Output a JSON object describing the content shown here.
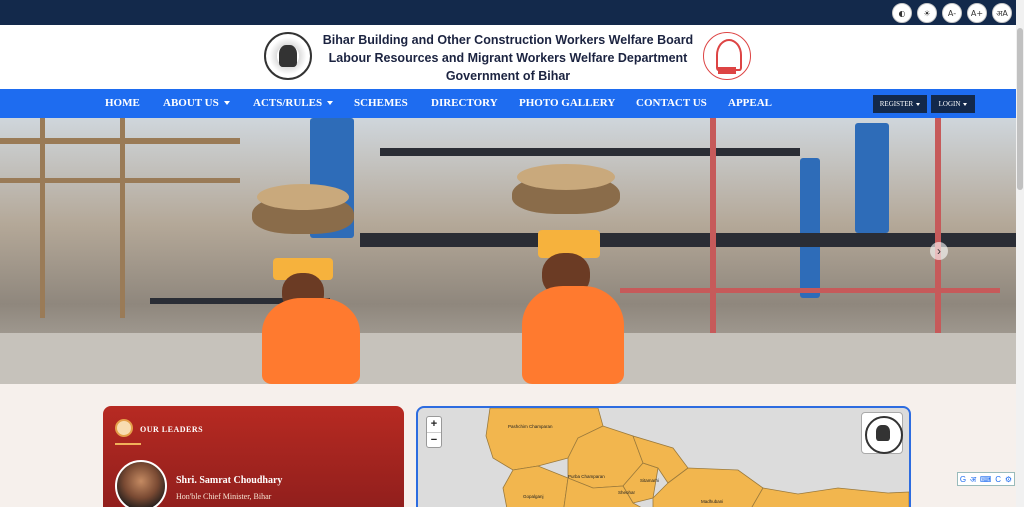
{
  "accessibility": {
    "buttons": [
      {
        "label": "◐",
        "icon": "contrast-icon"
      },
      {
        "label": "☀",
        "icon": "brightness-icon"
      },
      {
        "label": "A-",
        "icon": "font-decrease-icon"
      },
      {
        "label": "A+",
        "icon": "font-increase-icon"
      },
      {
        "label": "अA",
        "icon": "language-icon"
      }
    ]
  },
  "header": {
    "line1": "Bihar Building and Other Construction Workers Welfare Board",
    "line2": "Labour Resources and Migrant Workers Welfare Department",
    "line3": "Government of Bihar"
  },
  "nav": {
    "items": [
      "HOME",
      "ABOUT US",
      "ACTS/RULES",
      "SCHEMES",
      "DIRECTORY",
      "PHOTO GALLERY",
      "CONTACT US",
      "APPEAL"
    ],
    "register": "REGISTER",
    "login": "LOGIN"
  },
  "hero": {
    "next_arrow": "›"
  },
  "leaders": {
    "title": "OUR LEADERS",
    "name": "Shri. Samrat Choudhary",
    "role": "Hon'ble Chief Minister, Bihar"
  },
  "map": {
    "zoom_in": "+",
    "zoom_out": "−",
    "districts": [
      "Pashchim Champaran",
      "Purba Champaran",
      "Sitamarhi",
      "Gopalganj",
      "Sheohar",
      "Madhubani"
    ]
  },
  "translate": {
    "labels": [
      "G",
      "अ",
      "⌨",
      "C",
      "⚙"
    ]
  },
  "colors": {
    "topbar": "#13294b",
    "nav": "#1e6cf0",
    "leaders_card": "#b72a22",
    "map_land": "#f2b64e"
  }
}
